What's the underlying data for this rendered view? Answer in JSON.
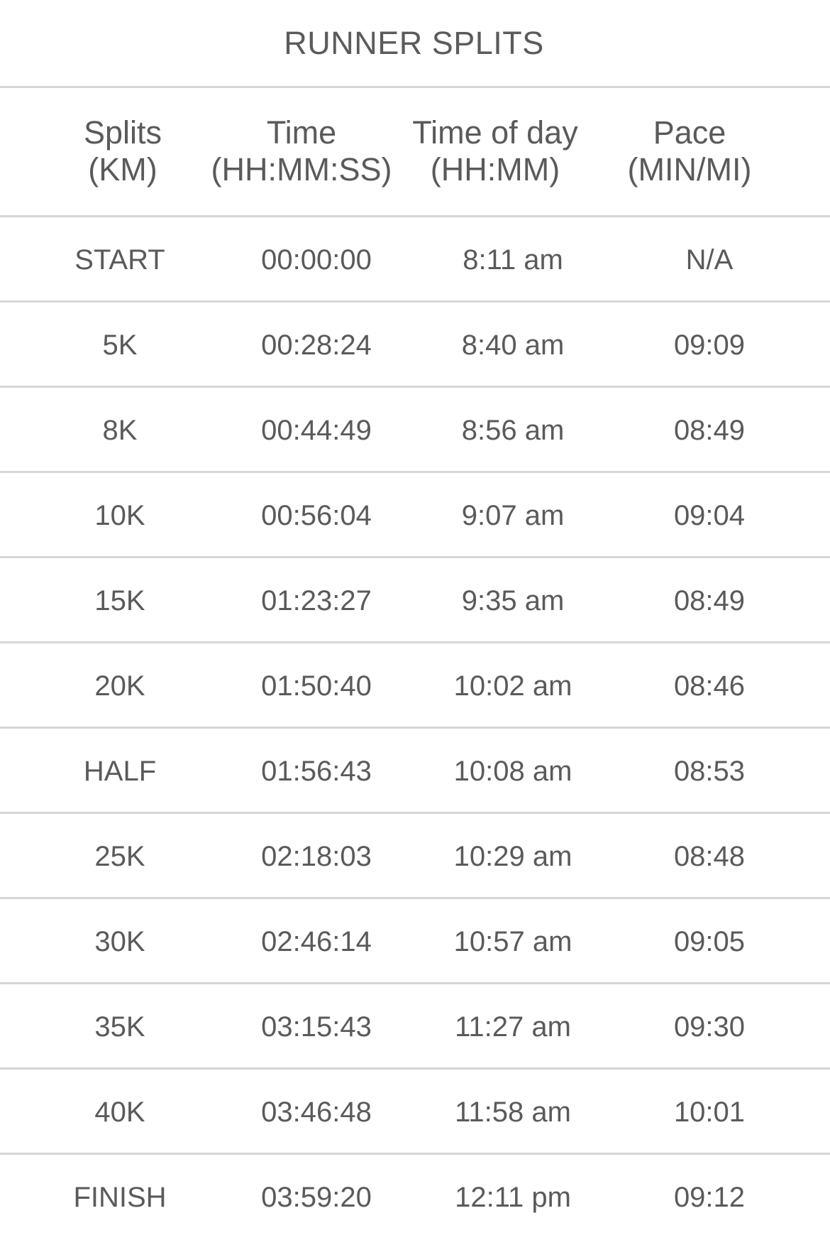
{
  "title": "RUNNER SPLITS",
  "headers": [
    {
      "line1": "Splits",
      "line2": "(KM)"
    },
    {
      "line1": "Time",
      "line2": "(HH:MM:SS)"
    },
    {
      "line1": "Time of day",
      "line2": "(HH:MM)"
    },
    {
      "line1": "Pace",
      "line2": "(MIN/MI)"
    }
  ],
  "rows": [
    {
      "split": "START",
      "time": "00:00:00",
      "time_of_day": "8:11 am",
      "pace": "N/A"
    },
    {
      "split": "5K",
      "time": "00:28:24",
      "time_of_day": "8:40 am",
      "pace": "09:09"
    },
    {
      "split": "8K",
      "time": "00:44:49",
      "time_of_day": "8:56 am",
      "pace": "08:49"
    },
    {
      "split": "10K",
      "time": "00:56:04",
      "time_of_day": "9:07 am",
      "pace": "09:04"
    },
    {
      "split": "15K",
      "time": "01:23:27",
      "time_of_day": "9:35 am",
      "pace": "08:49"
    },
    {
      "split": "20K",
      "time": "01:50:40",
      "time_of_day": "10:02 am",
      "pace": "08:46"
    },
    {
      "split": "HALF",
      "time": "01:56:43",
      "time_of_day": "10:08 am",
      "pace": "08:53"
    },
    {
      "split": "25K",
      "time": "02:18:03",
      "time_of_day": "10:29 am",
      "pace": "08:48"
    },
    {
      "split": "30K",
      "time": "02:46:14",
      "time_of_day": "10:57 am",
      "pace": "09:05"
    },
    {
      "split": "35K",
      "time": "03:15:43",
      "time_of_day": "11:27 am",
      "pace": "09:30"
    },
    {
      "split": "40K",
      "time": "03:46:48",
      "time_of_day": "11:58 am",
      "pace": "10:01"
    },
    {
      "split": "FINISH",
      "time": "03:59:20",
      "time_of_day": "12:11 pm",
      "pace": "09:12"
    }
  ]
}
